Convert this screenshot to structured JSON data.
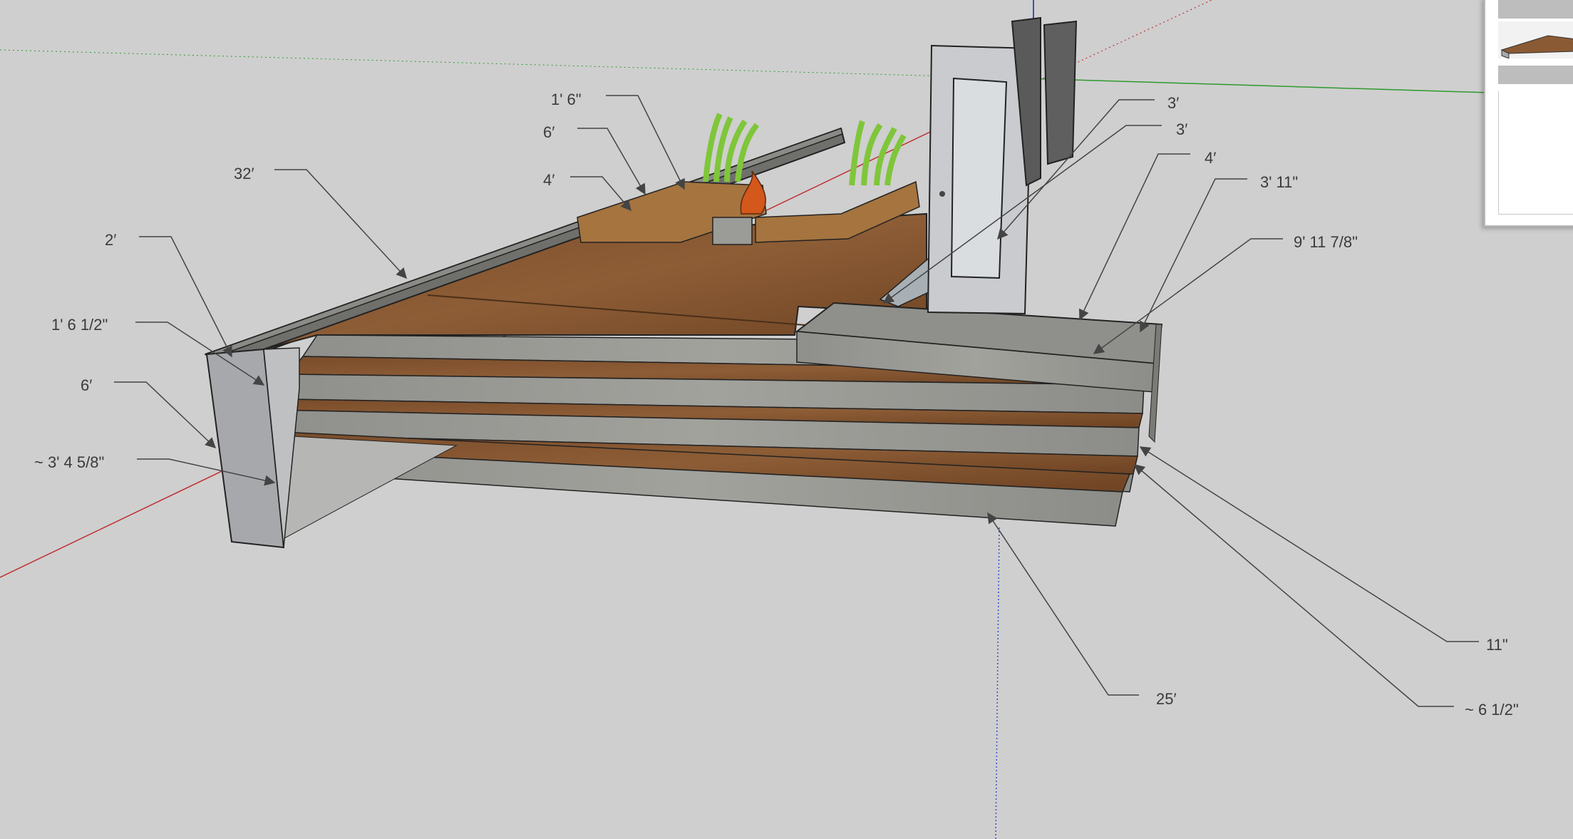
{
  "dimensions": {
    "d_32ft": "32′",
    "d_2ft": "2′",
    "d_1ft6_5in": "1' 6 1/2\"",
    "d_6ft_left": "6′",
    "d_3ft4_58": "~ 3' 4 5/8\"",
    "d_1ft6in": "1' 6\"",
    "d_6ft_top": "6′",
    "d_4ft_top": "4′",
    "d_3ft_a": "3′",
    "d_3ft_b": "3′",
    "d_4ft_right": "4′",
    "d_3ft11": "3' 11\"",
    "d_9ft11_78": "9' 11 7/8\"",
    "d_11in": "11\"",
    "d_6_5in": "~ 6 1/2\"",
    "d_25ft": "25′"
  },
  "colors": {
    "background": "#cfcfcf",
    "wood": "#8a5a34",
    "concrete": "#9a9a96",
    "axis_red": "#c03030",
    "axis_green": "#2e9a2e",
    "axis_blue": "#3a4fd0"
  },
  "icons": {
    "planter_left": "grass-planter-icon",
    "planter_right": "grass-planter-icon",
    "fire": "fire-pit-icon",
    "door": "door-icon"
  }
}
